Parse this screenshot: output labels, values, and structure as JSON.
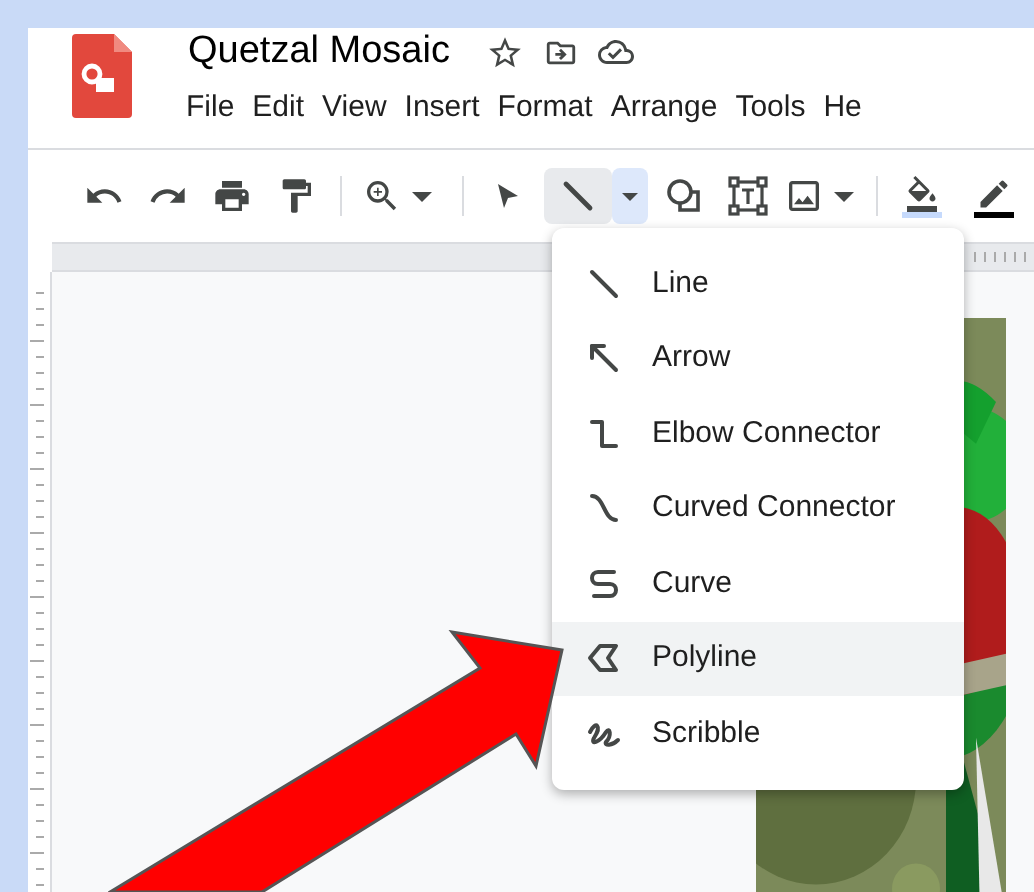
{
  "document": {
    "title": "Quetzal Mosaic"
  },
  "menu_bar": [
    "File",
    "Edit",
    "View",
    "Insert",
    "Format",
    "Arrange",
    "Tools",
    "He"
  ],
  "line_tool": {
    "selected": true
  },
  "line_menu": [
    {
      "label": "Line",
      "selected": false
    },
    {
      "label": "Arrow",
      "selected": false
    },
    {
      "label": "Elbow Connector",
      "selected": false
    },
    {
      "label": "Curved Connector",
      "selected": false
    },
    {
      "label": "Curve",
      "selected": false
    },
    {
      "label": "Polyline",
      "selected": true
    },
    {
      "label": "Scribble",
      "selected": false
    }
  ]
}
